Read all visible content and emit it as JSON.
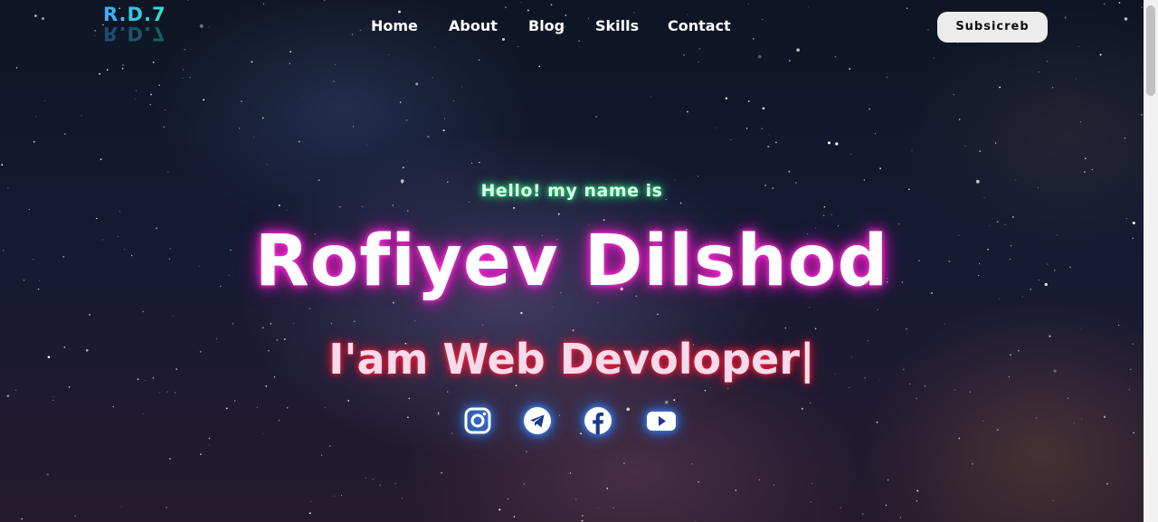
{
  "logo": {
    "text": "R.D.7"
  },
  "nav": {
    "items": [
      {
        "label": "Home"
      },
      {
        "label": "About"
      },
      {
        "label": "Blog"
      },
      {
        "label": "Skills"
      },
      {
        "label": "Contact"
      }
    ],
    "subscribe_label": "Subsicreb"
  },
  "hero": {
    "greeting": "Hello! my name is",
    "name": "Rofiyev Dilshod",
    "role": "I'am Web Devoloper|"
  },
  "socials": [
    {
      "icon": "instagram-icon"
    },
    {
      "icon": "telegram-icon"
    },
    {
      "icon": "facebook-icon"
    },
    {
      "icon": "youtube-icon"
    }
  ],
  "colors": {
    "greeting_glow": "#2ee07f",
    "name_glow": "#e81fc6",
    "role_glow": "#e0112e",
    "icon_glow": "#2b6fe8",
    "logo_gradient_start": "#3fa9ff",
    "logo_gradient_end": "#2ee6c8",
    "subscribe_bg": "#ececec"
  }
}
